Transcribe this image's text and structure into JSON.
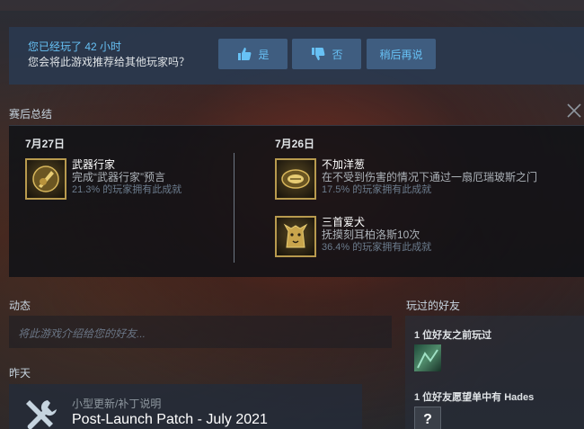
{
  "recommend": {
    "played_text": "您已经玩了 42 小时",
    "question": "您会将此游戏推荐给其他玩家吗？",
    "yes_label": "是",
    "no_label": "否",
    "later_label": "稍后再说"
  },
  "summary": {
    "heading": "赛后总结",
    "columns": [
      {
        "date": "7月27日",
        "achievements": [
          {
            "title": "武器行家",
            "desc": "完成“武器行家”预言",
            "pct": "21.3% 的玩家拥有此成就",
            "icon": "golden-weapon-icon"
          }
        ]
      },
      {
        "date": "7月26日",
        "achievements": [
          {
            "title": "不加洋葱",
            "desc": "在不受到伤害的情况下通过一扇厄瑞玻斯之门",
            "pct": "17.5% 的玩家拥有此成就",
            "icon": "golden-gate-icon"
          },
          {
            "title": "三首爱犬",
            "desc": "抚摸刻耳柏洛斯10次",
            "pct": "36.4% 的玩家拥有此成就",
            "icon": "golden-dog-icon"
          }
        ]
      }
    ]
  },
  "activity": {
    "heading": "动态",
    "placeholder": "将此游戏介绍给您的好友..."
  },
  "yesterday": {
    "heading": "昨天",
    "post_type": "小型更新/补丁说明",
    "post_title": "Post-Launch Patch - July 2021"
  },
  "friends": {
    "heading": "玩过的好友",
    "played_before": "1 位好友之前玩过",
    "wishlist": "1 位好友愿望单中有 Hades",
    "unknown_avatar": "?"
  },
  "colors": {
    "accent": "#66c0f4",
    "button_bg": "#3f5d80",
    "achievement_border": "#b89a4e"
  }
}
